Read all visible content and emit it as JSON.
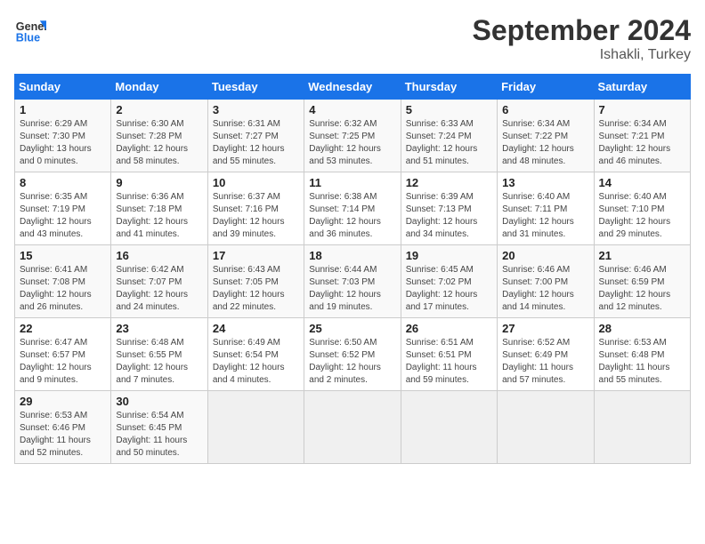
{
  "header": {
    "logo_line1": "General",
    "logo_line2": "Blue",
    "month": "September 2024",
    "location": "Ishakli, Turkey"
  },
  "weekdays": [
    "Sunday",
    "Monday",
    "Tuesday",
    "Wednesday",
    "Thursday",
    "Friday",
    "Saturday"
  ],
  "weeks": [
    [
      {
        "day": "1",
        "sunrise": "6:29 AM",
        "sunset": "7:30 PM",
        "daylight": "13 hours and 0 minutes."
      },
      {
        "day": "2",
        "sunrise": "6:30 AM",
        "sunset": "7:28 PM",
        "daylight": "12 hours and 58 minutes."
      },
      {
        "day": "3",
        "sunrise": "6:31 AM",
        "sunset": "7:27 PM",
        "daylight": "12 hours and 55 minutes."
      },
      {
        "day": "4",
        "sunrise": "6:32 AM",
        "sunset": "7:25 PM",
        "daylight": "12 hours and 53 minutes."
      },
      {
        "day": "5",
        "sunrise": "6:33 AM",
        "sunset": "7:24 PM",
        "daylight": "12 hours and 51 minutes."
      },
      {
        "day": "6",
        "sunrise": "6:34 AM",
        "sunset": "7:22 PM",
        "daylight": "12 hours and 48 minutes."
      },
      {
        "day": "7",
        "sunrise": "6:34 AM",
        "sunset": "7:21 PM",
        "daylight": "12 hours and 46 minutes."
      }
    ],
    [
      {
        "day": "8",
        "sunrise": "6:35 AM",
        "sunset": "7:19 PM",
        "daylight": "12 hours and 43 minutes."
      },
      {
        "day": "9",
        "sunrise": "6:36 AM",
        "sunset": "7:18 PM",
        "daylight": "12 hours and 41 minutes."
      },
      {
        "day": "10",
        "sunrise": "6:37 AM",
        "sunset": "7:16 PM",
        "daylight": "12 hours and 39 minutes."
      },
      {
        "day": "11",
        "sunrise": "6:38 AM",
        "sunset": "7:14 PM",
        "daylight": "12 hours and 36 minutes."
      },
      {
        "day": "12",
        "sunrise": "6:39 AM",
        "sunset": "7:13 PM",
        "daylight": "12 hours and 34 minutes."
      },
      {
        "day": "13",
        "sunrise": "6:40 AM",
        "sunset": "7:11 PM",
        "daylight": "12 hours and 31 minutes."
      },
      {
        "day": "14",
        "sunrise": "6:40 AM",
        "sunset": "7:10 PM",
        "daylight": "12 hours and 29 minutes."
      }
    ],
    [
      {
        "day": "15",
        "sunrise": "6:41 AM",
        "sunset": "7:08 PM",
        "daylight": "12 hours and 26 minutes."
      },
      {
        "day": "16",
        "sunrise": "6:42 AM",
        "sunset": "7:07 PM",
        "daylight": "12 hours and 24 minutes."
      },
      {
        "day": "17",
        "sunrise": "6:43 AM",
        "sunset": "7:05 PM",
        "daylight": "12 hours and 22 minutes."
      },
      {
        "day": "18",
        "sunrise": "6:44 AM",
        "sunset": "7:03 PM",
        "daylight": "12 hours and 19 minutes."
      },
      {
        "day": "19",
        "sunrise": "6:45 AM",
        "sunset": "7:02 PM",
        "daylight": "12 hours and 17 minutes."
      },
      {
        "day": "20",
        "sunrise": "6:46 AM",
        "sunset": "7:00 PM",
        "daylight": "12 hours and 14 minutes."
      },
      {
        "day": "21",
        "sunrise": "6:46 AM",
        "sunset": "6:59 PM",
        "daylight": "12 hours and 12 minutes."
      }
    ],
    [
      {
        "day": "22",
        "sunrise": "6:47 AM",
        "sunset": "6:57 PM",
        "daylight": "12 hours and 9 minutes."
      },
      {
        "day": "23",
        "sunrise": "6:48 AM",
        "sunset": "6:55 PM",
        "daylight": "12 hours and 7 minutes."
      },
      {
        "day": "24",
        "sunrise": "6:49 AM",
        "sunset": "6:54 PM",
        "daylight": "12 hours and 4 minutes."
      },
      {
        "day": "25",
        "sunrise": "6:50 AM",
        "sunset": "6:52 PM",
        "daylight": "12 hours and 2 minutes."
      },
      {
        "day": "26",
        "sunrise": "6:51 AM",
        "sunset": "6:51 PM",
        "daylight": "11 hours and 59 minutes."
      },
      {
        "day": "27",
        "sunrise": "6:52 AM",
        "sunset": "6:49 PM",
        "daylight": "11 hours and 57 minutes."
      },
      {
        "day": "28",
        "sunrise": "6:53 AM",
        "sunset": "6:48 PM",
        "daylight": "11 hours and 55 minutes."
      }
    ],
    [
      {
        "day": "29",
        "sunrise": "6:53 AM",
        "sunset": "6:46 PM",
        "daylight": "11 hours and 52 minutes."
      },
      {
        "day": "30",
        "sunrise": "6:54 AM",
        "sunset": "6:45 PM",
        "daylight": "11 hours and 50 minutes."
      },
      null,
      null,
      null,
      null,
      null
    ]
  ]
}
